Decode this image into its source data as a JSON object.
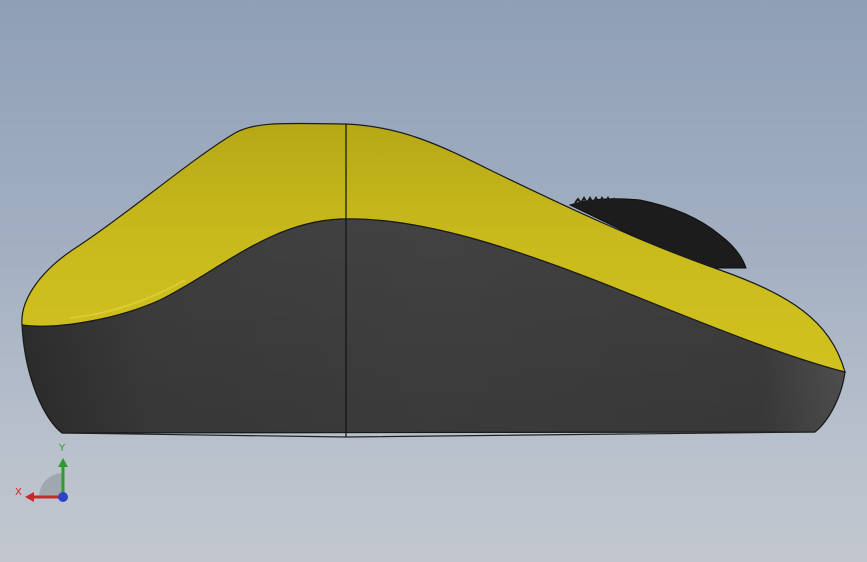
{
  "viewport": {
    "background_top": "#8f9fb6",
    "background_bottom": "#c2c7cf"
  },
  "model": {
    "name": "mouse-side-view",
    "colors": {
      "top_shell": "#c9b91c",
      "bottom_shell": "#3f3f3f",
      "scroll_wheel": "#1c1c1c",
      "edge": "#1a1a1a"
    }
  },
  "triad": {
    "x_label": "X",
    "y_label": "Y",
    "x_color": "#c42b2b",
    "y_color": "#2e9b32",
    "z_color": "#2a45c8"
  }
}
